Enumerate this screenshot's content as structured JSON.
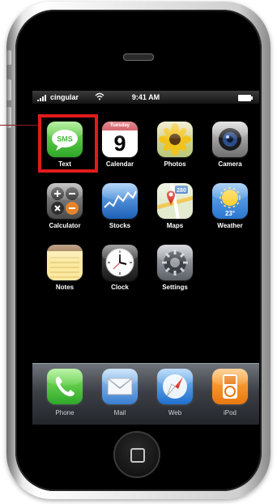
{
  "status_bar": {
    "carrier": "cingular",
    "time": "9:41 AM"
  },
  "apps": [
    {
      "name": "SMS",
      "label": "Text",
      "icon": "sms-icon",
      "color": "#44c53c",
      "glyph": "SMS"
    },
    {
      "name": "Calendar",
      "label": "Calendar",
      "icon": "calendar-icon",
      "color": "#ffffff",
      "day_name": "Tuesday",
      "day": "9"
    },
    {
      "name": "Photos",
      "label": "Photos",
      "icon": "sunflower-icon",
      "color": "#d7c98a"
    },
    {
      "name": "Camera",
      "label": "Camera",
      "icon": "camera-icon",
      "color": "#7e7e7e"
    },
    {
      "name": "Calculator",
      "label": "Calculator",
      "icon": "calculator-icon",
      "color": "#5d5d5d"
    },
    {
      "name": "Stocks",
      "label": "Stocks",
      "icon": "stocks-icon",
      "color": "#2f75cc"
    },
    {
      "name": "Maps",
      "label": "Maps",
      "icon": "maps-icon",
      "color": "#d7e4b8",
      "route_number": "280"
    },
    {
      "name": "Weather",
      "label": "Weather",
      "icon": "weather-icon",
      "color": "#3d8fe0",
      "temperature": "23°"
    },
    {
      "name": "Notes",
      "label": "Notes",
      "icon": "notes-icon",
      "color": "#f4e28a"
    },
    {
      "name": "Clock",
      "label": "Clock",
      "icon": "clock-icon",
      "color": "#2a2a2a"
    },
    {
      "name": "Settings",
      "label": "Settings",
      "icon": "gear-icon",
      "color": "#8a8f95"
    }
  ],
  "dock": [
    {
      "name": "Phone",
      "label": "Phone",
      "icon": "phone-icon",
      "color": "#4cc23b"
    },
    {
      "name": "Mail",
      "label": "Mail",
      "icon": "mail-icon",
      "color": "#6aa4e3"
    },
    {
      "name": "Web",
      "label": "Web",
      "icon": "compass-icon",
      "color": "#3a86d9"
    },
    {
      "name": "iPod",
      "label": "iPod",
      "icon": "ipod-icon",
      "color": "#f18b1f"
    }
  ],
  "callout": {
    "target": "Text",
    "color": "#e01b1b"
  }
}
